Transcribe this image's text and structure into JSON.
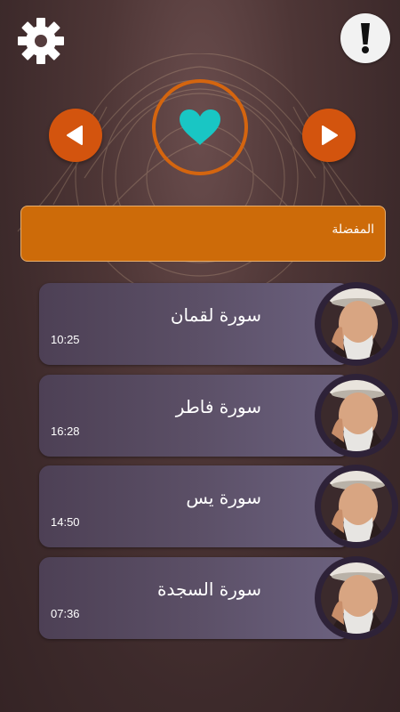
{
  "colors": {
    "accent": "#d3540e",
    "section_bar": "#cd6b09",
    "heart": "#19c6c4",
    "card": "#5b4f66",
    "background": "#4e3636"
  },
  "toolbar": {
    "settings_icon": "gear-icon",
    "info_icon": "exclamation-icon"
  },
  "navigator": {
    "prev_icon": "arrow-left-icon",
    "next_icon": "arrow-right-icon",
    "center_icon": "heart-icon"
  },
  "section": {
    "title": "المفضلة"
  },
  "tracks": [
    {
      "title": "سورة لقمان",
      "duration": "10:25"
    },
    {
      "title": "سورة فاطر",
      "duration": "16:28"
    },
    {
      "title": "سورة يس",
      "duration": "14:50"
    },
    {
      "title": "سورة السجدة",
      "duration": "07:36"
    }
  ]
}
